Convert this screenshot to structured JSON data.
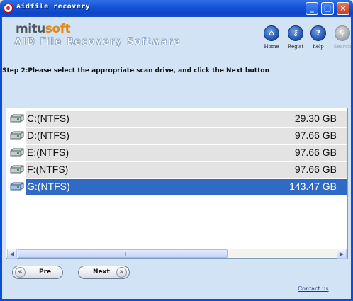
{
  "window": {
    "title": "Aidfile recovery",
    "controls": {
      "minimize": "_",
      "maximize": "□",
      "close": "×"
    }
  },
  "header": {
    "logo_main": "mitu",
    "logo_accent": "soft",
    "product_name": "AID File Recovery Software",
    "nav": [
      {
        "label": "Home",
        "icon": "home-icon",
        "glyph": "⌂",
        "enabled": true
      },
      {
        "label": "Regist",
        "icon": "key-icon",
        "glyph": "⚷",
        "enabled": true
      },
      {
        "label": "help",
        "icon": "question-icon",
        "glyph": "?",
        "enabled": true
      },
      {
        "label": "Search",
        "icon": "magnifier-icon",
        "glyph": "⚲",
        "enabled": false
      }
    ]
  },
  "step_text": "Step 2:Please select the appropriate scan drive, and click the Next button",
  "drives": [
    {
      "name": "C:(NTFS)",
      "size": "29.30 GB",
      "selected": false
    },
    {
      "name": "D:(NTFS)",
      "size": "97.66 GB",
      "selected": false
    },
    {
      "name": "E:(NTFS)",
      "size": "97.66 GB",
      "selected": false
    },
    {
      "name": "F:(NTFS)",
      "size": "97.66 GB",
      "selected": false
    },
    {
      "name": "G:(NTFS)",
      "size": "143.47 GB",
      "selected": true
    }
  ],
  "buttons": {
    "pre": "Pre",
    "next": "Next",
    "pre_arrow": "«",
    "next_arrow": "»"
  },
  "contact_link": "Contact us",
  "colors": {
    "title_bar": "#0d45c8",
    "client_bg": "#d3e3f6",
    "selection": "#316ac5",
    "link": "#1a3b8c"
  }
}
